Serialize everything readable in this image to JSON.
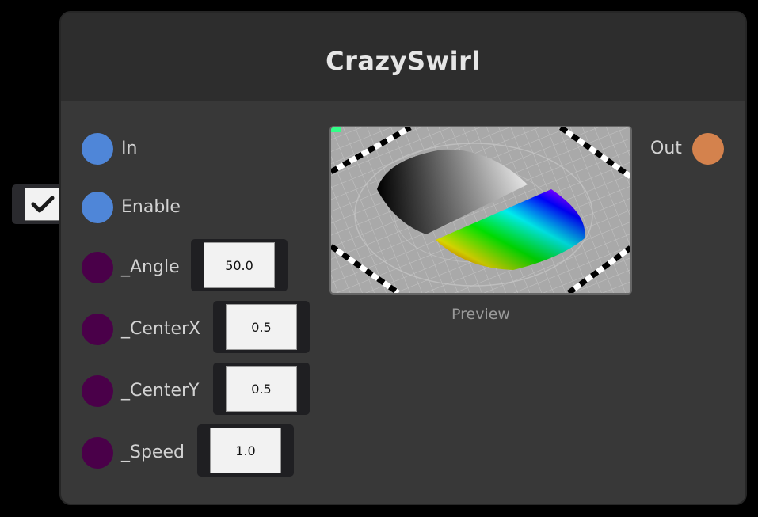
{
  "node": {
    "title": "CrazySwirl",
    "inputs": [
      {
        "label": "In",
        "color": "#4f86d8"
      },
      {
        "label": "Enable",
        "color": "#4f86d8",
        "checked": true
      },
      {
        "label": "_Angle",
        "color": "#4a0049",
        "value": "50.0"
      },
      {
        "label": "_CenterX",
        "color": "#4a0049",
        "value": "0.5"
      },
      {
        "label": "_CenterY",
        "color": "#4a0049",
        "value": "0.5"
      },
      {
        "label": "_Speed",
        "color": "#4a0049",
        "value": "1.0"
      }
    ],
    "output": {
      "label": "Out",
      "color": "#d4824d"
    },
    "preview_label": "Preview"
  },
  "icons": {
    "checkbox": "checkmark-icon"
  }
}
